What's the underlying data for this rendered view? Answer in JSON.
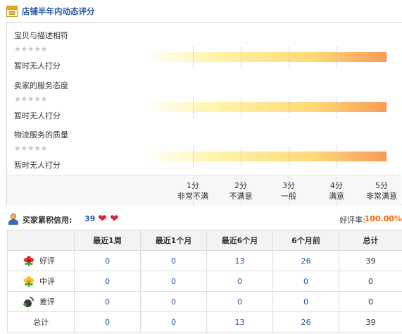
{
  "header": {
    "title": "店铺半年内动态评分"
  },
  "ratings": [
    {
      "label": "宝贝与描述相符",
      "stars": "★★★★★",
      "status": "暂时无人打分"
    },
    {
      "label": "卖家的服务态度",
      "stars": "★★★★★",
      "status": "暂时无人打分"
    },
    {
      "label": "物流服务的质量",
      "stars": "★★★★★",
      "status": "暂时无人打分"
    }
  ],
  "scale": [
    {
      "score": "1分",
      "desc": "非常不满"
    },
    {
      "score": "2分",
      "desc": "不满意"
    },
    {
      "score": "3分",
      "desc": "一般"
    },
    {
      "score": "4分",
      "desc": "满意"
    },
    {
      "score": "5分",
      "desc": "非常满意"
    }
  ],
  "credit": {
    "label": "买家累积信用:",
    "value": "39",
    "good_rate_label": "好评率:",
    "good_rate_value": "100.00%"
  },
  "table": {
    "headers": [
      "",
      "最近1周",
      "最近1个月",
      "最近6个月",
      "6个月前",
      "总计"
    ],
    "rows": [
      {
        "label": "好评",
        "icon": "red-flower-icon",
        "values": [
          "0",
          "0",
          "13",
          "26",
          "39"
        ]
      },
      {
        "label": "中评",
        "icon": "yellow-flower-icon",
        "values": [
          "0",
          "0",
          "0",
          "0",
          "0"
        ]
      },
      {
        "label": "差评",
        "icon": "bomb-icon",
        "values": [
          "0",
          "0",
          "0",
          "0",
          "0"
        ]
      },
      {
        "label": "总计",
        "icon": "",
        "values": [
          "0",
          "0",
          "13",
          "26",
          "39"
        ]
      }
    ]
  },
  "colors": {
    "title_blue": "#2756a5",
    "accent_orange": "#ff6600",
    "heart_red": "#e0213c"
  }
}
